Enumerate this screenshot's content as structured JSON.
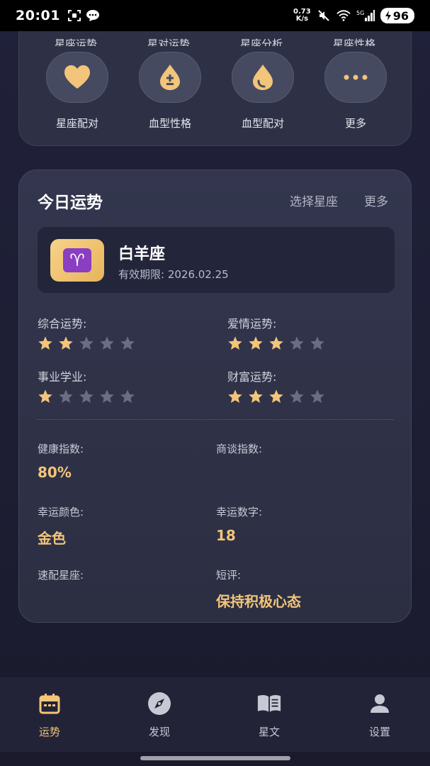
{
  "status_bar": {
    "time": "20:01",
    "net_speed_value": "0.73",
    "net_speed_unit": "K/s",
    "network": "5G",
    "battery": "96"
  },
  "top_categories": {
    "cut_labels": [
      "星座运势",
      "星对运势",
      "星座分析",
      "星座性格"
    ],
    "items": [
      {
        "label": "星座配对",
        "icon": "heart-icon"
      },
      {
        "label": "血型性格",
        "icon": "blood-plus-minus-icon"
      },
      {
        "label": "血型配对",
        "icon": "blood-drop-icon"
      },
      {
        "label": "更多",
        "icon": "more-dots-icon"
      }
    ]
  },
  "fortune": {
    "title": "今日运势",
    "select_sign": "选择星座",
    "more": "更多",
    "sign": {
      "symbol": "♈",
      "name": "白羊座",
      "valid_until": "有效期限: 2026.02.25"
    },
    "ratings": [
      {
        "label": "综合运势:",
        "stars": 2,
        "max": 5
      },
      {
        "label": "爱情运势:",
        "stars": 3,
        "max": 5
      },
      {
        "label": "事业学业:",
        "stars": 1,
        "max": 5
      },
      {
        "label": "财富运势:",
        "stars": 3,
        "max": 5
      }
    ],
    "info": [
      {
        "label": "健康指数:",
        "value": "80%"
      },
      {
        "label": "商谈指数:",
        "value": ""
      },
      {
        "label": "幸运颜色:",
        "value": "金色"
      },
      {
        "label": "幸运数字:",
        "value": "18"
      },
      {
        "label": "速配星座:",
        "value": ""
      },
      {
        "label": "短评:",
        "value": "保持积极心态"
      }
    ]
  },
  "bottom_nav": [
    {
      "label": "运势",
      "icon": "calendar-icon",
      "active": true
    },
    {
      "label": "发现",
      "icon": "compass-icon",
      "active": false
    },
    {
      "label": "星文",
      "icon": "book-icon",
      "active": false
    },
    {
      "label": "设置",
      "icon": "user-icon",
      "active": false
    }
  ],
  "colors": {
    "accent": "#f2c57a",
    "star_filled": "#f2c57a",
    "star_empty": "#6b6e83",
    "card_bg": "#2e3146",
    "background": "#1d1e33"
  }
}
